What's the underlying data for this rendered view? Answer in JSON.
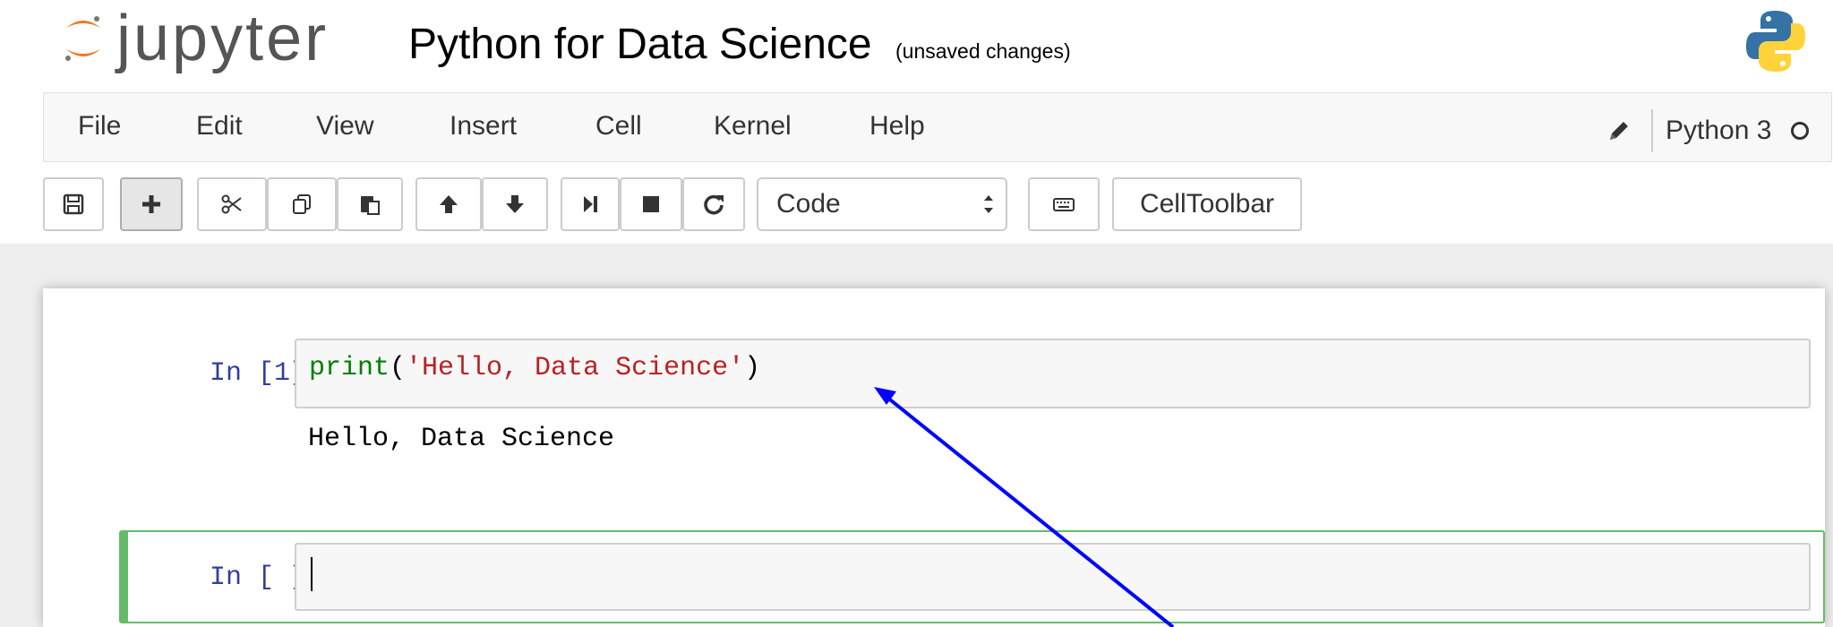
{
  "header": {
    "logo_text": "jupyter",
    "notebook_title": "Python for Data Science",
    "save_status": "(unsaved changes)"
  },
  "menu": {
    "items": [
      "File",
      "Edit",
      "View",
      "Insert",
      "Cell",
      "Kernel",
      "Help"
    ],
    "kernel_name": "Python 3"
  },
  "toolbar": {
    "cell_type": "Code",
    "celltoolbar_label": "CellToolbar",
    "icons": [
      "save-icon",
      "plus-icon",
      "scissors-icon",
      "copy-icon",
      "paste-icon",
      "arrow-up-icon",
      "arrow-down-icon",
      "step-forward-icon",
      "stop-icon",
      "restart-icon",
      "keyboard-icon"
    ]
  },
  "cells": [
    {
      "prompt": "In [1]:",
      "code_func": "print",
      "code_open": "(",
      "code_str": "'Hello, Data Science'",
      "code_close": ")",
      "output": "Hello, Data Science"
    },
    {
      "prompt": "In [ ]:",
      "code": ""
    }
  ],
  "colors": {
    "prompt": "#303f9f",
    "keyword": "#008000",
    "string": "#ba2121",
    "selected_border": "#66bb6a",
    "annotation_arrow": "#0000ff"
  }
}
